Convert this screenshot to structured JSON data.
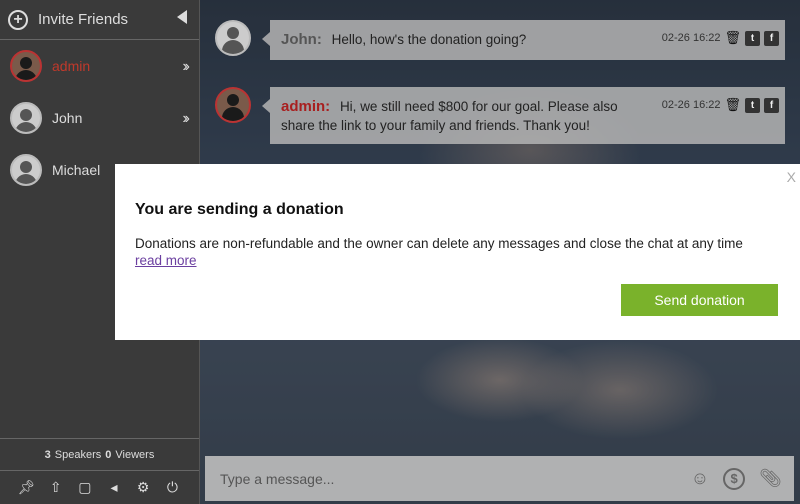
{
  "sidebar": {
    "invite_label": "Invite Friends",
    "users": [
      {
        "name": "admin",
        "role": "admin"
      },
      {
        "name": "John",
        "role": "user"
      },
      {
        "name": "Michael",
        "role": "user"
      }
    ],
    "speakers_count": "3",
    "speakers_label": "Speakers",
    "viewers_count": "0",
    "viewers_label": "Viewers"
  },
  "messages": [
    {
      "sender": "John:",
      "text": "Hello, how's the donation going?",
      "time": "02-26 16:22"
    },
    {
      "sender": "admin:",
      "text": "Hi, we still need $800 for our goal. Please also share the link to your family and friends. Thank you!",
      "time": "02-26 16:22"
    }
  ],
  "modal": {
    "close": "X",
    "title": "You are sending a donation",
    "text": "Donations are non-refundable and the owner can delete any messages and close the chat at any time",
    "read_more": "read more",
    "send_label": "Send donation"
  },
  "composer": {
    "placeholder": "Type a message..."
  },
  "colors": {
    "accent_green": "#7ab22b",
    "admin_red": "#a81f1f"
  }
}
